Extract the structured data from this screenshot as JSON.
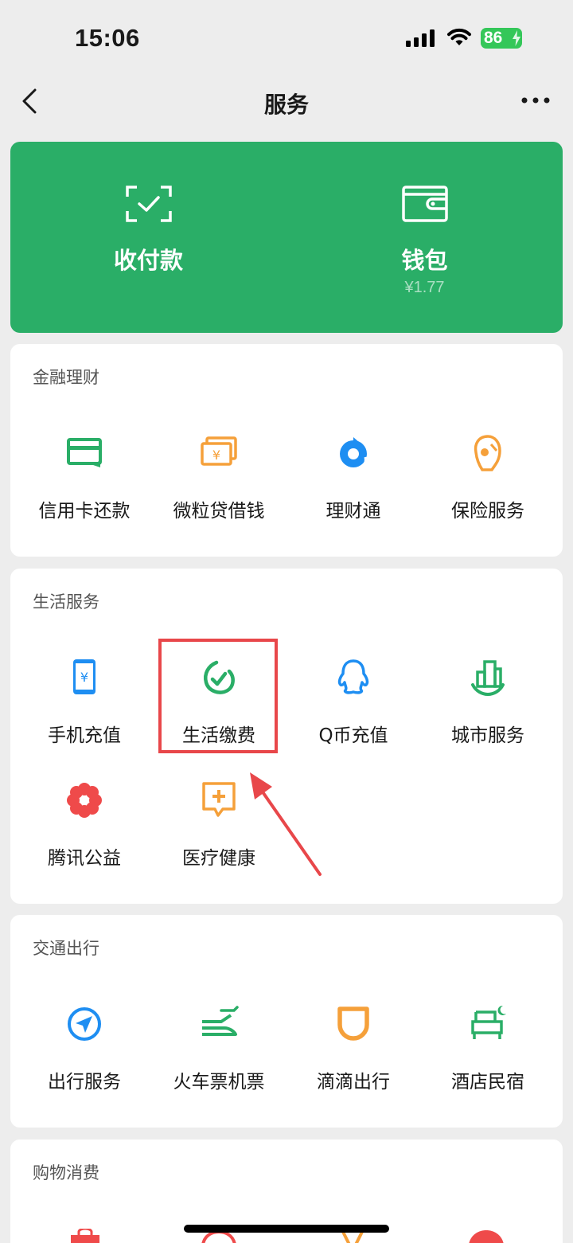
{
  "status_bar": {
    "time": "15:06",
    "battery": "86"
  },
  "nav": {
    "title": "服务"
  },
  "banner": {
    "pay": {
      "label": "收付款"
    },
    "wallet": {
      "label": "钱包",
      "balance": "¥1.77"
    }
  },
  "sections": {
    "finance": {
      "title": "金融理财",
      "items": [
        {
          "label": "信用卡还款",
          "icon": "credit-card-icon"
        },
        {
          "label": "微粒贷借钱",
          "icon": "loan-icon"
        },
        {
          "label": "理财通",
          "icon": "wealth-icon"
        },
        {
          "label": "保险服务",
          "icon": "insurance-icon"
        }
      ]
    },
    "life": {
      "title": "生活服务",
      "items": [
        {
          "label": "手机充值",
          "icon": "phone-recharge-icon"
        },
        {
          "label": "生活缴费",
          "icon": "utility-payment-icon"
        },
        {
          "label": "Q币充值",
          "icon": "qq-coin-icon"
        },
        {
          "label": "城市服务",
          "icon": "city-service-icon"
        },
        {
          "label": "腾讯公益",
          "icon": "charity-icon"
        },
        {
          "label": "医疗健康",
          "icon": "medical-icon"
        }
      ]
    },
    "travel": {
      "title": "交通出行",
      "items": [
        {
          "label": "出行服务",
          "icon": "travel-service-icon"
        },
        {
          "label": "火车票机票",
          "icon": "train-plane-icon"
        },
        {
          "label": "滴滴出行",
          "icon": "didi-icon"
        },
        {
          "label": "酒店民宿",
          "icon": "hotel-icon"
        }
      ]
    },
    "shopping": {
      "title": "购物消费"
    }
  },
  "colors": {
    "green": "#2aae67",
    "orange": "#f5a03a",
    "blue": "#1e8ef2",
    "red": "#ef4a4a",
    "annotation": "#e8474a"
  }
}
